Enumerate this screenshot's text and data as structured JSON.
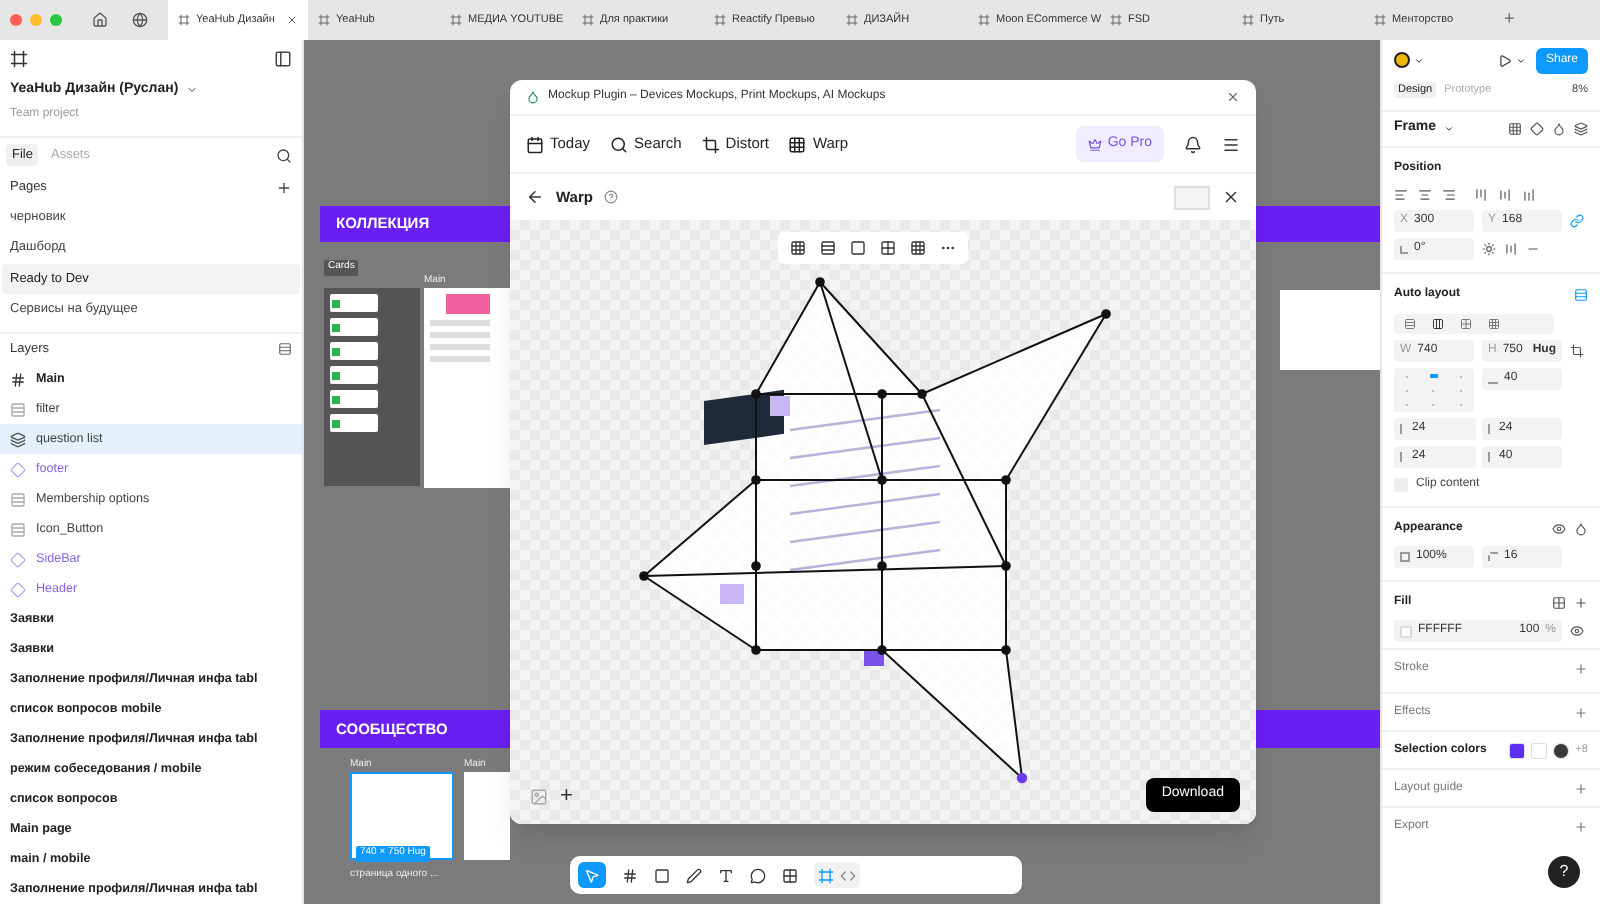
{
  "tabs_bar": {
    "tabs": [
      {
        "label": "YeaHub Дизайн",
        "selected": true
      },
      {
        "label": "YeaHub",
        "selected": false
      },
      {
        "label": "МЕДИА YOUTUBE",
        "selected": false
      },
      {
        "label": "Для практики",
        "selected": false
      },
      {
        "label": "Reactify Превью",
        "selected": false
      },
      {
        "label": "ДИЗАЙН",
        "selected": false
      },
      {
        "label": "Moon ECommerce W",
        "selected": false
      },
      {
        "label": "FSD",
        "selected": false
      },
      {
        "label": "Путь",
        "selected": false
      },
      {
        "label": "Менторство",
        "selected": false
      }
    ],
    "new_tab": "+"
  },
  "left": {
    "file_title": "YeaHub Дизайн (Руслан)",
    "subtitle": "Team project",
    "file_tabs": [
      {
        "label": "File",
        "selected": true
      },
      {
        "label": "Assets",
        "selected": false
      }
    ],
    "pages_title": "Pages",
    "pages": [
      {
        "label": "черновик",
        "selected": false
      },
      {
        "label": "Дашборд",
        "selected": false
      },
      {
        "label": "Ready to Dev",
        "selected": true
      },
      {
        "label": "Сервисы на будущее",
        "selected": false
      }
    ],
    "layers_title": "Layers",
    "layers": [
      {
        "name": "Main",
        "kind": "frame",
        "selected": false
      },
      {
        "name": "filter",
        "kind": "autolayout",
        "selected": false
      },
      {
        "name": "question list",
        "kind": "stack",
        "selected": true
      },
      {
        "name": "footer",
        "kind": "instance",
        "selected": false
      },
      {
        "name": "Membership options",
        "kind": "autolayout",
        "selected": false
      },
      {
        "name": "Icon_Button",
        "kind": "autolayout",
        "selected": false
      },
      {
        "name": "SideBar",
        "kind": "instance",
        "selected": false
      },
      {
        "name": "Header",
        "kind": "instance",
        "selected": false
      },
      {
        "name": "Заявки",
        "kind": "top",
        "selected": false
      },
      {
        "name": "Заявки",
        "kind": "top",
        "selected": false
      },
      {
        "name": "Заполнение профиля/Личная инфа tabl",
        "kind": "top",
        "selected": false
      },
      {
        "name": "список вопросов mobile",
        "kind": "top",
        "selected": false
      },
      {
        "name": "Заполнение профиля/Личная инфа tabl",
        "kind": "top",
        "selected": false
      },
      {
        "name": "режим собеседования / mobile",
        "kind": "top",
        "selected": false
      },
      {
        "name": "список вопросов",
        "kind": "top",
        "selected": false
      },
      {
        "name": "Main page",
        "kind": "top",
        "selected": false
      },
      {
        "name": "main / mobile",
        "kind": "top",
        "selected": false
      },
      {
        "name": "Заполнение профиля/Личная инфа tabl",
        "kind": "top",
        "selected": false
      }
    ]
  },
  "canvas": {
    "sections": [
      "КОЛЛЕКЦИЯ",
      "СООБЩЕСТВО"
    ],
    "cards_label": "Cards",
    "main_labels": [
      "Main",
      "Main",
      "Main"
    ],
    "size_badge": "740 × 750 Hug",
    "caption": "страница одного ...",
    "dev_mode": false
  },
  "plugin": {
    "title": "Mockup Plugin – Devices Mockups, Print Mockups, AI Mockups",
    "nav": [
      {
        "label": "Today"
      },
      {
        "label": "Search"
      },
      {
        "label": "Distort"
      },
      {
        "label": "Warp"
      }
    ],
    "go_pro": "Go Pro",
    "page_title": "Warp",
    "download": "Download",
    "add": "+"
  },
  "right": {
    "share": "Share",
    "tabs": [
      {
        "label": "Design",
        "selected": true
      },
      {
        "label": "Prototype",
        "selected": false
      }
    ],
    "zoom": "8%",
    "frame_type": "Frame",
    "position_title": "Position",
    "x": {
      "label": "X",
      "value": "300"
    },
    "y": {
      "label": "Y",
      "value": "168"
    },
    "rotation": "0°",
    "autolayout_title": "Auto layout",
    "w": {
      "label": "W",
      "value": "740"
    },
    "h": {
      "label": "H",
      "value": "750",
      "mode": "Hug"
    },
    "gap": "40",
    "paddings": [
      "24",
      "24",
      "24",
      "40"
    ],
    "clip": {
      "label": "Clip content",
      "checked": false
    },
    "appearance_title": "Appearance",
    "opacity": "100%",
    "radius": "16",
    "fill_title": "Fill",
    "fill": {
      "hex": "FFFFFF",
      "opacity": "100",
      "unit": "%"
    },
    "sections": [
      "Stroke",
      "Effects"
    ],
    "selection_colors": {
      "label": "Selection colors",
      "colors": [
        {
          "color": "#5b2ff0"
        },
        {
          "color": "#ffffff"
        },
        {
          "color": "#3a3a3a"
        }
      ],
      "more": "+8"
    },
    "sections2": [
      "Layout guide",
      "Export"
    ],
    "help": "?"
  }
}
